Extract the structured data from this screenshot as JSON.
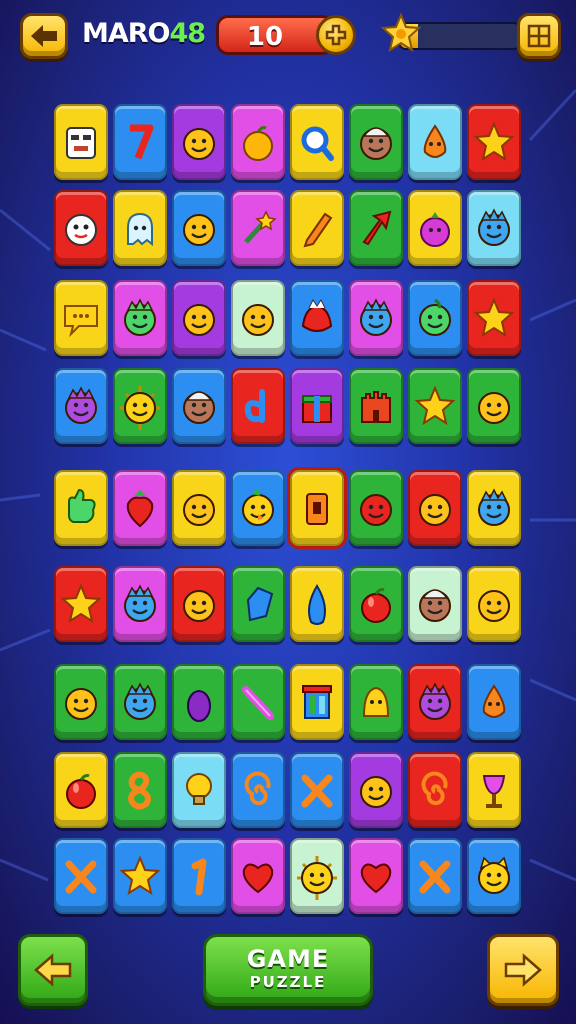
{
  "header": {
    "back_icon": "arrow-left-icon",
    "logo_text": "MARO",
    "logo_number": "48",
    "score": "10",
    "coin_icon": "plus-coin-icon",
    "progress_fraction": 0.15,
    "star_icon": "star-badge-icon",
    "menu_icon": "grid-menu-icon"
  },
  "colors": {
    "yellow": "#f9d51a",
    "blue": "#2b8ef0",
    "purple": "#a43be0",
    "magenta": "#e24fe6",
    "green": "#2fb43a",
    "light_blue": "#7bdcf5",
    "red": "#e8251e",
    "pale": "#c8f3d2",
    "orange": "#f08a14"
  },
  "board": {
    "rows": [
      [
        [
          "yellow",
          "robot-face"
        ],
        [
          "blue",
          "seven-number"
        ],
        [
          "purple",
          "smiley-face"
        ],
        [
          "magenta",
          "apple"
        ],
        [
          "yellow",
          "magnifier"
        ],
        [
          "green",
          "acorn-face"
        ],
        [
          "light_blue",
          "drop-monster"
        ],
        [
          "red",
          "star"
        ]
      ],
      [
        [
          "red",
          "ghost-face"
        ],
        [
          "yellow",
          "ghost"
        ],
        [
          "blue",
          "smiley-face"
        ],
        [
          "magenta",
          "star-wand"
        ],
        [
          "yellow",
          "pencil"
        ],
        [
          "green",
          "arrow"
        ],
        [
          "yellow",
          "berry"
        ],
        [
          "light_blue",
          "blue-monster"
        ]
      ],
      [
        [
          "yellow",
          "speech-bubble"
        ],
        [
          "magenta",
          "green-monster"
        ],
        [
          "purple",
          "smiley-face"
        ],
        [
          "pale",
          "smiley-face"
        ],
        [
          "blue",
          "red-dragon"
        ],
        [
          "magenta",
          "blue-monster"
        ],
        [
          "blue",
          "green-drop"
        ],
        [
          "red",
          "star"
        ]
      ],
      [
        [
          "blue",
          "purple-monster"
        ],
        [
          "green",
          "sun-face"
        ],
        [
          "blue",
          "acorn-face"
        ],
        [
          "red",
          "letter-d"
        ],
        [
          "purple",
          "gift-box"
        ],
        [
          "green",
          "castle"
        ],
        [
          "green",
          "star"
        ],
        [
          "green",
          "smiley-face"
        ]
      ],
      [
        [
          "yellow",
          "green-hand"
        ],
        [
          "magenta",
          "strawberry"
        ],
        [
          "yellow",
          "smiley-face"
        ],
        [
          "blue",
          "bird-face"
        ],
        [
          "yellow",
          "lantern"
        ],
        [
          "green",
          "red-face"
        ],
        [
          "red",
          "smiley-face"
        ],
        [
          "yellow",
          "blue-monster"
        ]
      ],
      [
        [
          "red",
          "star"
        ],
        [
          "magenta",
          "blue-monster"
        ],
        [
          "red",
          "smiley-face"
        ],
        [
          "green",
          "blue-gem"
        ],
        [
          "yellow",
          "blue-drop"
        ],
        [
          "green",
          "red-apple"
        ],
        [
          "pale",
          "acorn-face"
        ],
        [
          "yellow",
          "smiley-face"
        ]
      ],
      [
        [
          "green",
          "smiley-face"
        ],
        [
          "green",
          "blue-monster"
        ],
        [
          "green",
          "eggplant"
        ],
        [
          "green",
          "stick"
        ],
        [
          "yellow",
          "jar"
        ],
        [
          "green",
          "bell-monster"
        ],
        [
          "red",
          "purple-monster"
        ],
        [
          "blue",
          "drop-monster"
        ]
      ],
      [
        [
          "yellow",
          "red-apple"
        ],
        [
          "green",
          "eight-number"
        ],
        [
          "light_blue",
          "light-bulb"
        ],
        [
          "blue",
          "spiral"
        ],
        [
          "blue",
          "x-mark"
        ],
        [
          "purple",
          "smiley-face"
        ],
        [
          "red",
          "spiral"
        ],
        [
          "yellow",
          "magic-glass"
        ]
      ],
      [
        [
          "blue",
          "x-mark"
        ],
        [
          "blue",
          "star"
        ],
        [
          "blue",
          "one-number"
        ],
        [
          "magenta",
          "heart"
        ],
        [
          "pale",
          "sun-face"
        ],
        [
          "magenta",
          "heart"
        ],
        [
          "blue",
          "x-mark"
        ],
        [
          "blue",
          "cat-face"
        ]
      ]
    ]
  },
  "footer": {
    "prev_icon": "arrow-left-icon",
    "game_line1": "GAME",
    "game_line2": "PUZZLE",
    "next_icon": "arrow-right-icon"
  }
}
